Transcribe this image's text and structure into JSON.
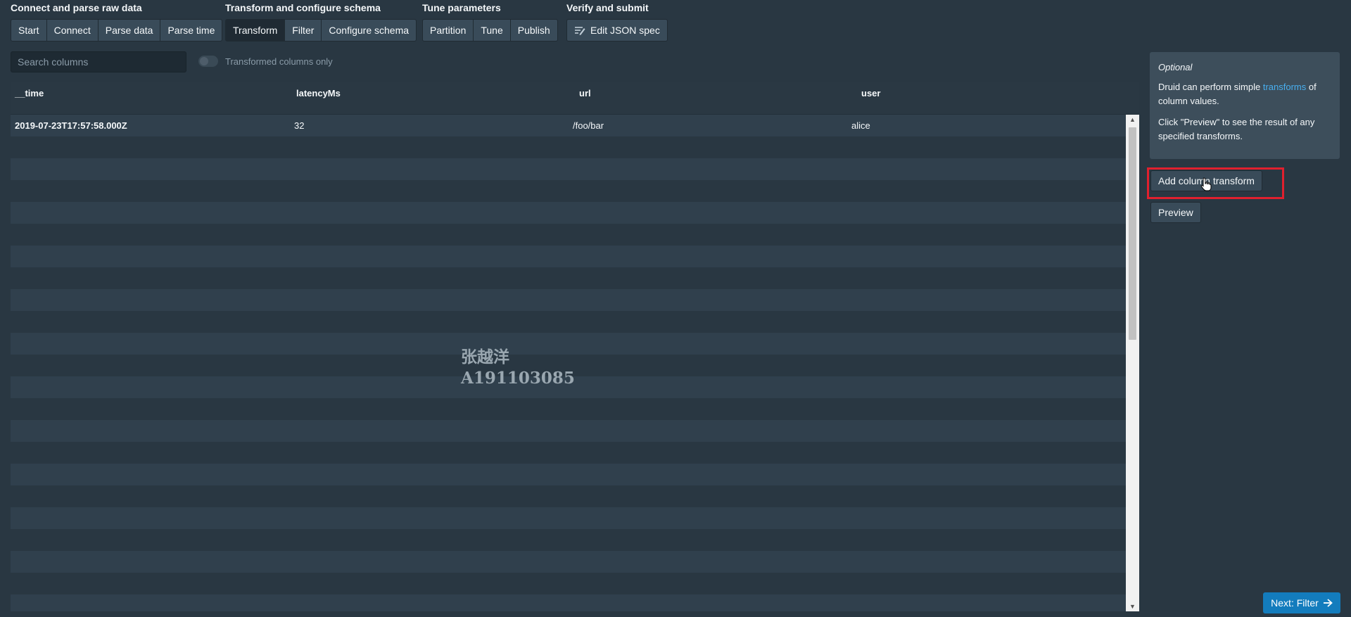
{
  "steps": [
    {
      "title": "Connect and parse raw data",
      "buttons": [
        "Start",
        "Connect",
        "Parse data",
        "Parse time"
      ]
    },
    {
      "title": "Transform and configure schema",
      "buttons": [
        "Transform",
        "Filter",
        "Configure schema"
      ]
    },
    {
      "title": "Tune parameters",
      "buttons": [
        "Partition",
        "Tune",
        "Publish"
      ]
    },
    {
      "title": "Verify and submit",
      "buttons": [
        "Edit JSON spec"
      ]
    }
  ],
  "active_step": "Transform",
  "search": {
    "placeholder": "Search columns"
  },
  "toggle": {
    "label": "Transformed columns only",
    "checked": false
  },
  "table": {
    "columns": [
      "__time",
      "latencyMs",
      "url",
      "user"
    ],
    "rows": [
      [
        "2019-07-23T17:57:58.000Z",
        "32",
        "/foo/bar",
        "alice"
      ]
    ]
  },
  "watermark": {
    "line1": "张越洋",
    "line2": "A191103085"
  },
  "callout": {
    "heading": "Optional",
    "p1_before": "Druid can perform simple ",
    "p1_link": "transforms",
    "p1_after": " of column values.",
    "p2": "Click \"Preview\" to see the result of any specified transforms."
  },
  "actions": {
    "add_transform": "Add column transform",
    "preview": "Preview",
    "next": "Next: Filter"
  },
  "icons": {
    "edit_json": "edit-json-icon",
    "next": "arrow-right-icon"
  },
  "colors": {
    "background": "#293742",
    "primary": "#137cbd",
    "link": "#48aff0",
    "highlight": "#e0202e"
  }
}
